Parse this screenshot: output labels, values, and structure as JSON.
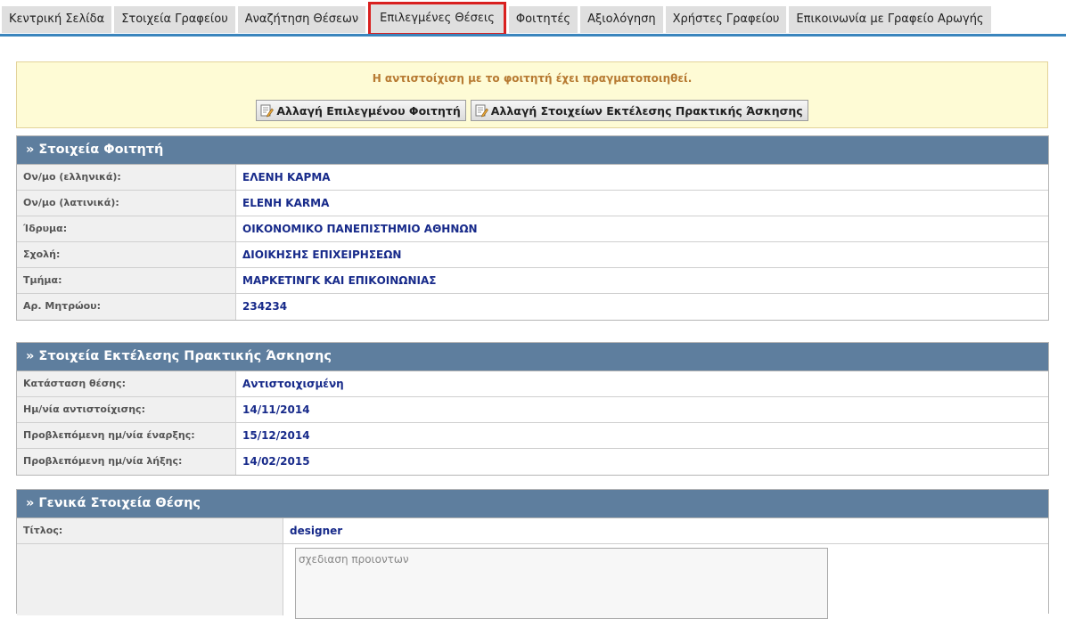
{
  "nav": {
    "tabs": [
      {
        "label": "Κεντρική Σελίδα"
      },
      {
        "label": "Στοιχεία Γραφείου"
      },
      {
        "label": "Αναζήτηση Θέσεων"
      },
      {
        "label": "Επιλεγμένες Θέσεις",
        "active": true
      },
      {
        "label": "Φοιτητές"
      },
      {
        "label": "Αξιολόγηση"
      },
      {
        "label": "Χρήστες Γραφείου"
      },
      {
        "label": "Επικοινωνία με Γραφείο Αρωγής"
      }
    ],
    "accent_color": "#3a85bd",
    "active_highlight_color": "#d9201f"
  },
  "notice": {
    "message": "Η αντιστοίχιση με το φοιτητή έχει πραγματοποιηθεί.",
    "buttons": [
      {
        "label": "Αλλαγή Επιλεγμένου Φοιτητή",
        "icon": "edit-document-icon"
      },
      {
        "label": "Αλλαγή Στοιχείων Εκτέλεσης Πρακτικής Άσκησης",
        "icon": "edit-document-icon"
      }
    ]
  },
  "student_section": {
    "title": "» Στοιχεία Φοιτητή",
    "rows": [
      {
        "label": "Ον/μο (ελληνικά):",
        "value": "ΕΛΕΝΗ ΚΑΡΜΑ"
      },
      {
        "label": "Ον/μο (λατινικά):",
        "value": "ELENH KARMA"
      },
      {
        "label": "Ίδρυμα:",
        "value": "ΟΙΚΟΝΟΜΙΚΟ ΠΑΝΕΠΙΣΤΗΜΙΟ ΑΘΗΝΩΝ"
      },
      {
        "label": "Σχολή:",
        "value": "ΔΙΟΙΚΗΣΗΣ ΕΠΙΧΕΙΡΗΣΕΩΝ"
      },
      {
        "label": "Τμήμα:",
        "value": "ΜΑΡΚΕΤΙΝΓΚ ΚΑΙ ΕΠΙΚΟΙΝΩΝΙΑΣ"
      },
      {
        "label": "Αρ. Μητρώου:",
        "value": "234234"
      }
    ]
  },
  "execution_section": {
    "title": "» Στοιχεία Εκτέλεσης Πρακτικής Άσκησης",
    "rows": [
      {
        "label": "Κατάσταση θέσης:",
        "value": "Αντιστοιχισμένη"
      },
      {
        "label": "Ημ/νία αντιστοίχισης:",
        "value": "14/11/2014"
      },
      {
        "label": "Προβλεπόμενη ημ/νία έναρξης:",
        "value": "15/12/2014"
      },
      {
        "label": "Προβλεπόμενη ημ/νία λήξης:",
        "value": "14/02/2015"
      }
    ]
  },
  "general_section": {
    "title": "» Γενικά Στοιχεία Θέσης",
    "rows": [
      {
        "label": "Τίτλος:",
        "value": "designer"
      }
    ],
    "description": "σχεδιαση προιοντων"
  },
  "colors": {
    "section_header_bg": "#5e7e9e",
    "value_text": "#172a8a",
    "notice_bg": "#fefbd5",
    "notice_text": "#b77a32"
  }
}
